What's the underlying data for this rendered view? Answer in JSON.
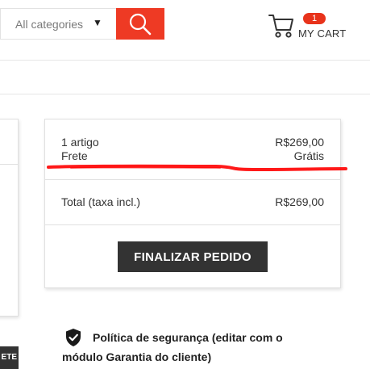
{
  "header": {
    "category_select": {
      "value": "All categories",
      "caret": "▼"
    },
    "search_button": {
      "icon": "search-icon"
    },
    "cart": {
      "icon": "cart-icon",
      "badge_count": "1",
      "label": "MY CART"
    }
  },
  "summary": {
    "items_label": "1 artigo",
    "items_value": "R$269,00",
    "shipping_label": "Frete",
    "shipping_value": "Grátis",
    "total_label": "Total (taxa incl.)",
    "total_value": "R$269,00",
    "checkout_label": "FINALIZAR PEDIDO"
  },
  "left_panel": {
    "button_label": "ETE"
  },
  "reassurance": {
    "icon": "shield-check-icon",
    "text": "Política de segurança (editar com o módulo Garantia do cliente)"
  },
  "colors": {
    "accent": "#ee3a24",
    "badge": "#e8331b",
    "dark_button": "#333333",
    "annotation": "#ff0000"
  }
}
